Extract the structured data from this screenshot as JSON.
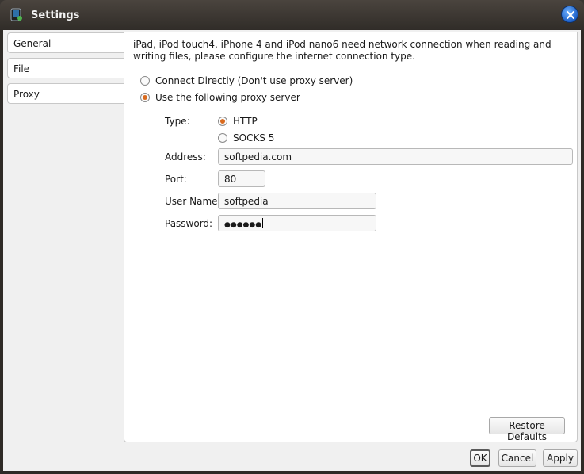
{
  "window": {
    "title": "Settings"
  },
  "sidebar": {
    "tabs": [
      {
        "label": "General"
      },
      {
        "label": "File"
      },
      {
        "label": "Proxy"
      }
    ]
  },
  "proxy": {
    "intro": "iPad, iPod touch4, iPhone 4 and iPod nano6 need network connection when reading and writing files, please configure the internet connection type.",
    "mode_options": [
      {
        "label": "Connect Directly (Don't use proxy server)",
        "selected": false
      },
      {
        "label": "Use the following proxy server",
        "selected": true
      }
    ],
    "type_label": "Type:",
    "type_options": [
      {
        "label": "HTTP",
        "selected": true
      },
      {
        "label": "SOCKS 5",
        "selected": false
      }
    ],
    "address_label": "Address:",
    "address_value": "softpedia.com",
    "port_label": "Port:",
    "port_value": "80",
    "username_label": "User Name:",
    "username_value": "softpedia",
    "password_label": "Password:",
    "password_value": "●●●●●●",
    "restore_label": "Restore Defaults"
  },
  "footer": {
    "ok_label": "OK",
    "cancel_label": "Cancel",
    "apply_label": "Apply"
  },
  "colors": {
    "radio_selected": "#d96a1e",
    "titlebar": "#2f2b27",
    "close_button": "#1c5fc7"
  }
}
